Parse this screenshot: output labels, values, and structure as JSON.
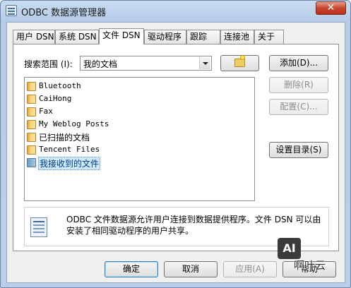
{
  "window": {
    "title": "ODBC 数据源管理器",
    "close_glyph": "✕"
  },
  "tabs": [
    {
      "label": "用户 DSN"
    },
    {
      "label": "系统 DSN"
    },
    {
      "label": "文件 DSN",
      "active": true
    },
    {
      "label": "驱动程序"
    },
    {
      "label": "跟踪"
    },
    {
      "label": "连接池"
    },
    {
      "label": "关于"
    }
  ],
  "lookin": {
    "label": "搜索范围 (I):",
    "value": "我的文档"
  },
  "files": [
    {
      "name": "Bluetooth"
    },
    {
      "name": "CaiHong"
    },
    {
      "name": "Fax"
    },
    {
      "name": "My Weblog Posts"
    },
    {
      "name": "已扫描的文档"
    },
    {
      "name": "Tencent Files"
    },
    {
      "name": "我接收到的文件",
      "selected": true
    }
  ],
  "side_buttons": {
    "add": "添加(D)...",
    "remove": "删除(R)",
    "configure": "配置(C)...",
    "set_dir": "设置目录(S)"
  },
  "info": {
    "text": "ODBC 文件数据源允许用户连接到数据提供程序。文件 DSN 可以由安装了相同驱动程序的用户共享。"
  },
  "footer": {
    "ok": "确定",
    "cancel": "取消",
    "apply": "应用(A)",
    "help": "帮助"
  },
  "watermark": {
    "logo": "AI",
    "text": "啊叶云"
  }
}
